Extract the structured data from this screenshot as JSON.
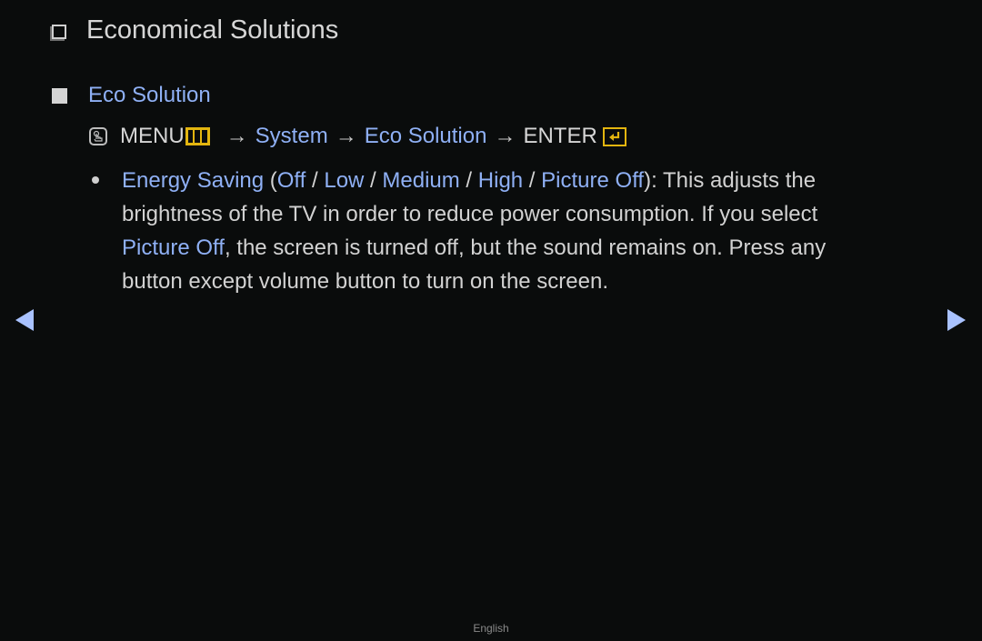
{
  "title": {
    "icon": "hollow-square-icon",
    "text": "Economical Solutions"
  },
  "section": {
    "icon": "filled-square-icon",
    "text": "Eco Solution"
  },
  "path": {
    "hand_icon": "remote-hand-icon",
    "menu": "MENU",
    "menu_icon": "menu-button-icon",
    "arrow": "→",
    "system": "System",
    "eco_solution": "Eco Solution",
    "enter": "ENTER",
    "enter_icon": "enter-button-icon"
  },
  "bullet": {
    "label": "Energy Saving",
    "open_paren": " (",
    "options": [
      "Off",
      "Low",
      "Medium",
      "High",
      "Picture Off"
    ],
    "separator": " / ",
    "close_paren": "): ",
    "text1": "This adjusts the brightness of the TV in order to reduce power consumption. If you select ",
    "highlight2": "Picture Off",
    "text2": ", the screen is turned off, but the sound remains on. Press any button except volume button to turn on the screen."
  },
  "nav": {
    "prev_icon": "left-triangle-icon",
    "next_icon": "right-triangle-icon"
  },
  "footer": {
    "language": "English"
  },
  "colors": {
    "background": "#0a0c0c",
    "link": "#8fb0f5",
    "text": "#d2d2d2",
    "accent_yellow": "#e3b50f",
    "nav_arrow": "#a9c2ff"
  }
}
